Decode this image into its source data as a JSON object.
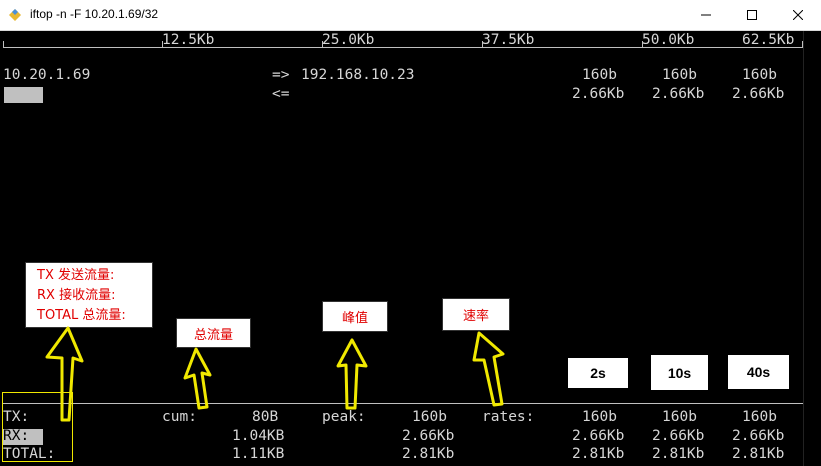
{
  "window": {
    "title": "iftop -n -F 10.20.1.69/32"
  },
  "scale": [
    "12.5Kb",
    "25.0Kb",
    "37.5Kb",
    "50.0Kb",
    "62.5Kb"
  ],
  "flow": {
    "src": "10.20.1.69",
    "out_arrow": "=>",
    "in_arrow": "<=",
    "dst": "192.168.10.23",
    "out_rates": [
      "160b",
      "160b",
      "160b"
    ],
    "in_rates": [
      "2.66Kb",
      "2.66Kb",
      "2.66Kb"
    ]
  },
  "totals": {
    "tx_label": "TX:",
    "rx_label": "RX:",
    "total_label": "TOTAL:",
    "cum_label": "cum:",
    "peak_label": "peak:",
    "rates_label": "rates:",
    "tx": {
      "cum": "80B",
      "peak": "160b",
      "rates": [
        "160b",
        "160b",
        "160b"
      ]
    },
    "rx": {
      "cum": "1.04KB",
      "peak": "2.66Kb",
      "rates": [
        "2.66Kb",
        "2.66Kb",
        "2.66Kb"
      ]
    },
    "total": {
      "cum": "1.11KB",
      "peak": "2.81Kb",
      "rates": [
        "2.81Kb",
        "2.81Kb",
        "2.81Kb"
      ]
    }
  },
  "annotations": {
    "legend": [
      "TX 发送流量:",
      "RX 接收流量:",
      "TOTAL 总流量:"
    ],
    "cum": "总流量",
    "peak": "峰值",
    "rate": "速率",
    "intervals": [
      "2s",
      "10s",
      "40s"
    ]
  },
  "colors": {
    "annotation_text": "#e00000",
    "arrow": "#f0e800",
    "terminal_text": "#d6d6d6"
  }
}
